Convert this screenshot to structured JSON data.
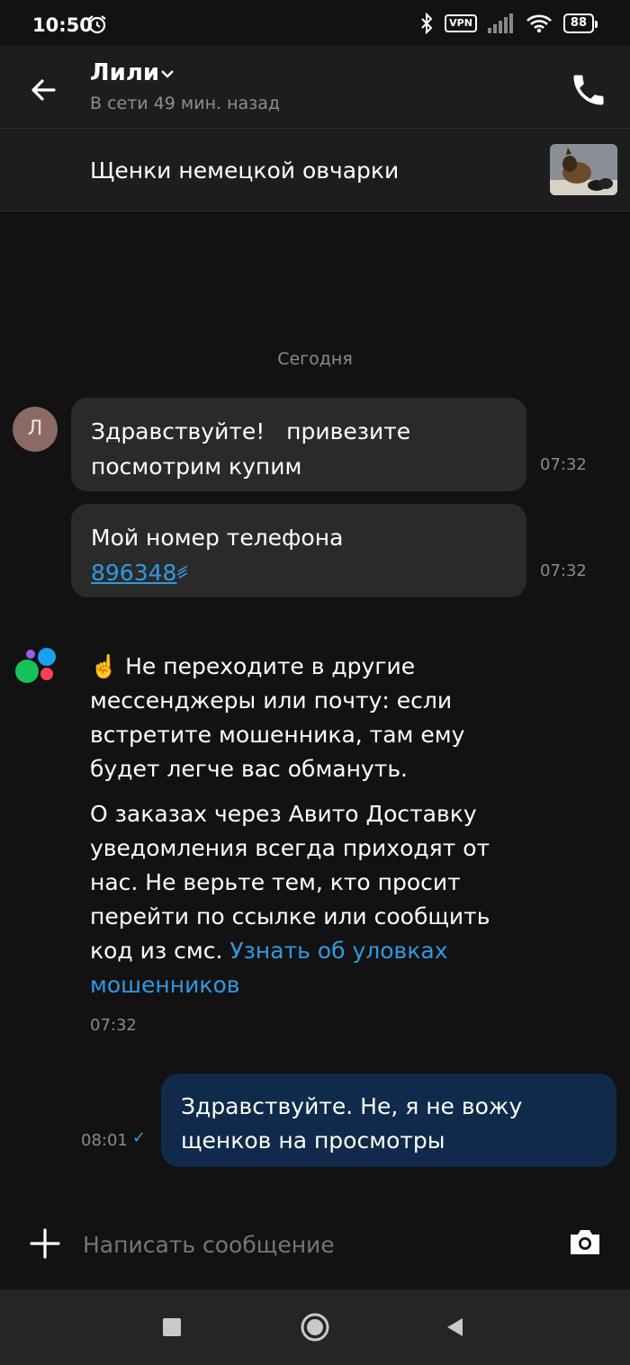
{
  "status_bar": {
    "time": "10:50",
    "vpn": "VPN",
    "battery": "88"
  },
  "header": {
    "contact_name": "Лили",
    "status": "В сети 49 мин. назад"
  },
  "ad": {
    "title": "Щенки немецкой овчарки"
  },
  "chat": {
    "date_separator": "Сегодня",
    "avatar_initial": "Л",
    "incoming": [
      {
        "line1": "Здравствуйте!   привезите",
        "line2": "посмотрим купим",
        "time": "07:32"
      },
      {
        "line1": "Мой номер телефона",
        "phone": "896348",
        "time": "07:32"
      }
    ],
    "system": {
      "emoji": "☝️",
      "p1": "Не переходите в другие мессенджеры или почту: если встретите мошенника, там ему будет легче вас обмануть.",
      "p2_text": "О заказах через Авито Доставку уведомления всегда приходят от нас. Не верьте тем, кто просит перейти по ссылке или сообщить код из смс.",
      "p2_link": "Узнать об уловках мошенников",
      "time": "07:32"
    },
    "outgoing": {
      "text": "Здравствуйте. Не, я не вожу щенков на просмотры",
      "time": "08:01",
      "status": "✓"
    }
  },
  "composer": {
    "placeholder": "Написать сообщение"
  },
  "colors": {
    "link": "#2f9ae0",
    "outgoing_bubble": "#0f2a4a",
    "incoming_bubble": "#2a2a2a"
  }
}
